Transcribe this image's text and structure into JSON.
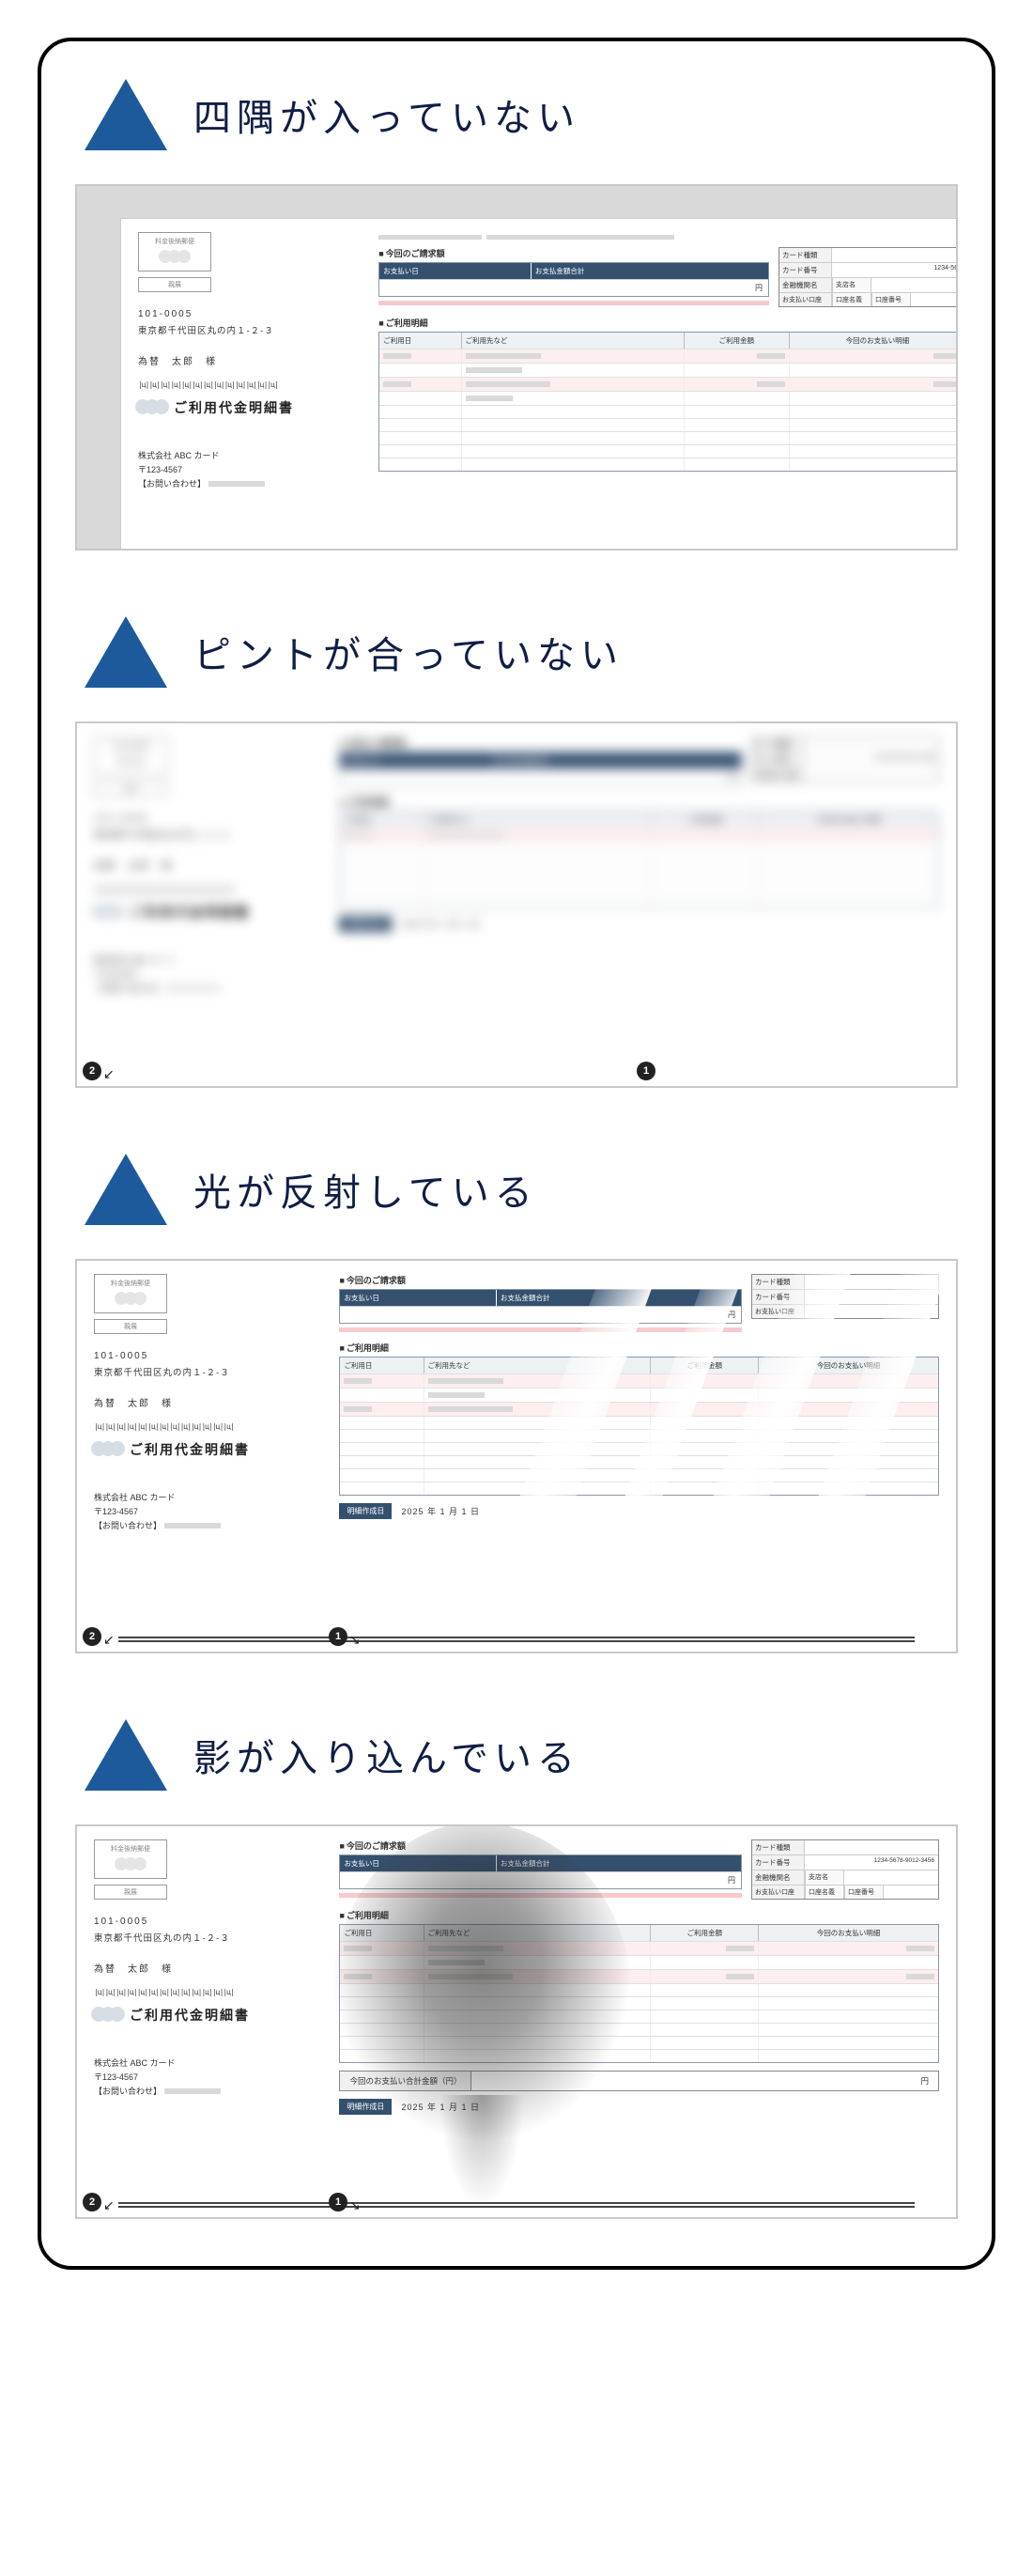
{
  "sections": [
    {
      "title": "四隅が入っていない"
    },
    {
      "title": "ピントが合っていない"
    },
    {
      "title": "光が反射している"
    },
    {
      "title": "影が入り込んでいる"
    }
  ],
  "doc": {
    "stamp_label": "料金後納郵便",
    "stamp_sub": "親展",
    "postal": "101-0005",
    "address": "東京都千代田区丸の内１-２-３",
    "payee": "為替　太郎　様",
    "barcode": "|ц||ц||ц||ц||ц||ц||ц||ц||ц||ц||ц||ц||ц|",
    "title": "ご利用代金明細書",
    "issuer": "株式会社 ABC カード",
    "issuer_postal": "〒123-4567",
    "issuer_contact": "【お問い合わせ】",
    "billing_label": "今回のご請求額",
    "bill_head1": "お支払い日",
    "bill_head2": "お支払金額合計",
    "bill_yen": "円",
    "detail_label": "ご利用明細",
    "dt_h1": "ご利用日",
    "dt_h2": "ご利用先など",
    "dt_h3": "ご利用金額",
    "dt_h4": "今回のお支払い明細",
    "card_info": {
      "k1": "カード種類",
      "k2": "カード番号",
      "v2": "1234-5678-9012-3456",
      "k3": "金融機関名",
      "k4": "お支払い口座",
      "sk1": "支店名",
      "sk2": "口座番号",
      "sk3": "口座名義"
    },
    "footer_tag": "明細作成日",
    "footer_date": "2025 年 1 月 1 日",
    "total_label": "今回のお支払い合計金額（円）",
    "total_value": "円"
  },
  "badges": {
    "left": "2",
    "right": "1"
  }
}
